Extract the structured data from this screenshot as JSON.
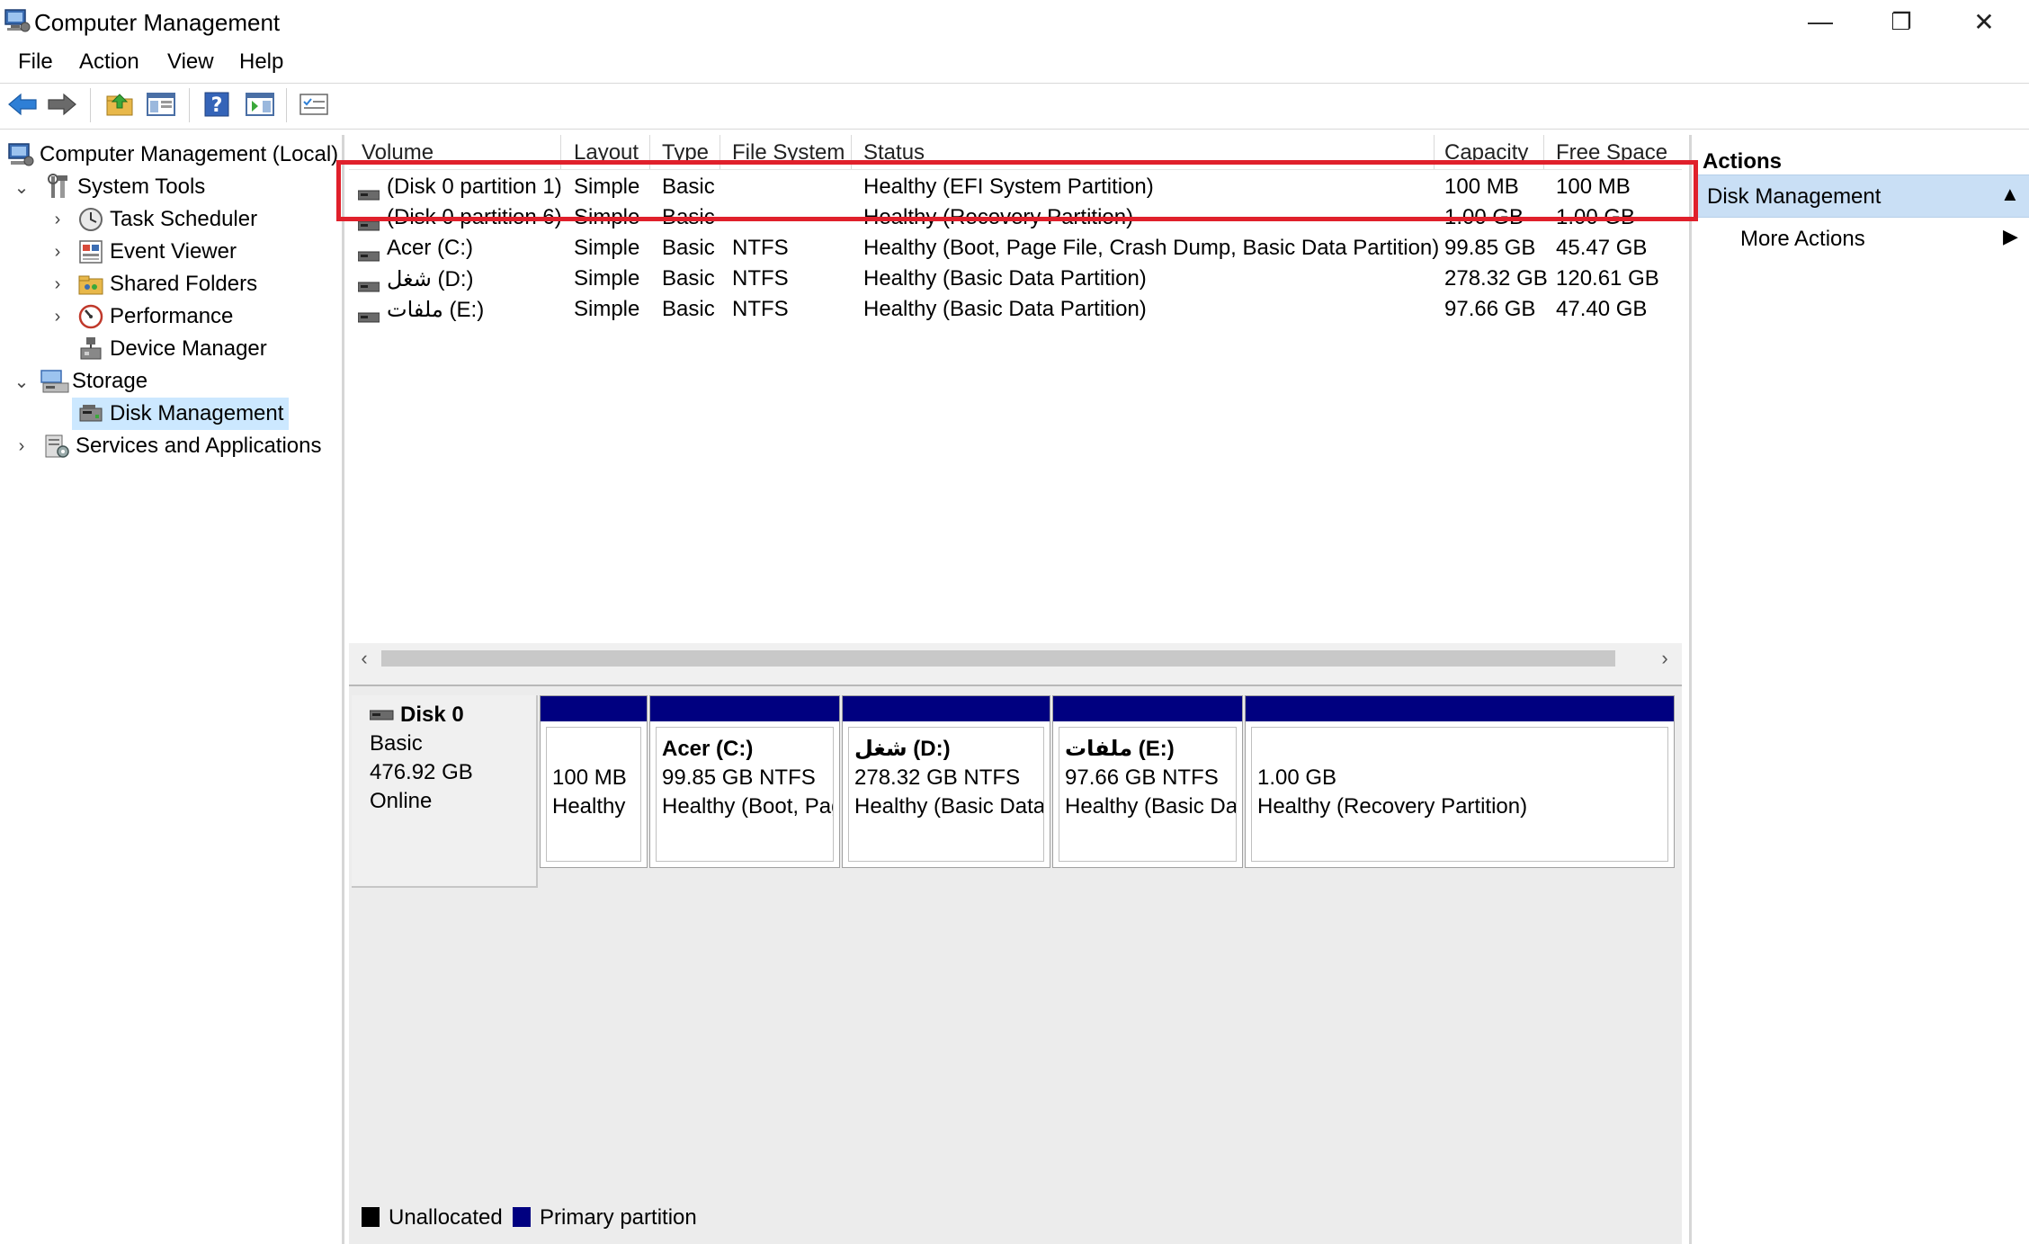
{
  "window": {
    "title": "Computer Management",
    "minimize_glyph": "—",
    "restore_glyph": "❐",
    "close_glyph": "✕"
  },
  "menu": [
    "File",
    "Action",
    "View",
    "Help"
  ],
  "toolbar": [
    "back-arrow-icon",
    "forward-arrow-icon",
    "up-folder-icon",
    "show-hide-console-tree-icon",
    "help-icon",
    "show-hide-action-pane-icon",
    "properties-icon"
  ],
  "tree": {
    "root": "Computer Management (Local)",
    "system_tools": "System Tools",
    "task_scheduler": "Task Scheduler",
    "event_viewer": "Event Viewer",
    "shared_folders": "Shared Folders",
    "performance": "Performance",
    "device_manager": "Device Manager",
    "storage": "Storage",
    "disk_management": "Disk Management",
    "services": "Services and Applications"
  },
  "volume_table": {
    "headers": [
      "Volume",
      "Layout",
      "Type",
      "File System",
      "Status",
      "Capacity",
      "Free Space"
    ],
    "rows": [
      [
        "(Disk 0 partition 1)",
        "Simple",
        "Basic",
        "",
        "Healthy (EFI System Partition)",
        "100 MB",
        "100 MB"
      ],
      [
        "(Disk 0 partition 6)",
        "Simple",
        "Basic",
        "",
        "Healthy (Recovery Partition)",
        "1.00 GB",
        "1.00 GB"
      ],
      [
        "Acer (C:)",
        "Simple",
        "Basic",
        "NTFS",
        "Healthy (Boot, Page File, Crash Dump, Basic Data Partition)",
        "99.85 GB",
        "45.47 GB"
      ],
      [
        "شغل (D:)",
        "Simple",
        "Basic",
        "NTFS",
        "Healthy (Basic Data Partition)",
        "278.32 GB",
        "120.61 GB"
      ],
      [
        "ملفات (E:)",
        "Simple",
        "Basic",
        "NTFS",
        "Healthy (Basic Data Partition)",
        "97.66 GB",
        "47.40 GB"
      ]
    ]
  },
  "disk": {
    "name": "Disk 0",
    "type": "Basic",
    "size": "476.92 GB",
    "status": "Online",
    "partitions": [
      {
        "title": "",
        "line1": "100 MB",
        "line2": "Healthy"
      },
      {
        "title": "Acer  (C:)",
        "line1": "99.85 GB NTFS",
        "line2": "Healthy (Boot, Page File, Crash Dump, Basic Data Partition)"
      },
      {
        "title": "شغل  (D:)",
        "line1": "278.32 GB NTFS",
        "line2": "Healthy (Basic Data Partition)"
      },
      {
        "title": "ملفات  (E:)",
        "line1": "97.66 GB NTFS",
        "line2": "Healthy (Basic Data Partition)"
      },
      {
        "title": "",
        "line1": "1.00 GB",
        "line2": "Healthy (Recovery Partition)"
      }
    ]
  },
  "legend": {
    "unallocated": "Unallocated",
    "primary": "Primary partition",
    "unallocated_color": "#000000",
    "primary_color": "#000080"
  },
  "actions": {
    "header": "Actions",
    "section": "Disk Management",
    "more": "More Actions"
  },
  "colors": {
    "highlight": "#e0202b",
    "selection": "#cce8ff",
    "partition_bar": "#000080"
  }
}
